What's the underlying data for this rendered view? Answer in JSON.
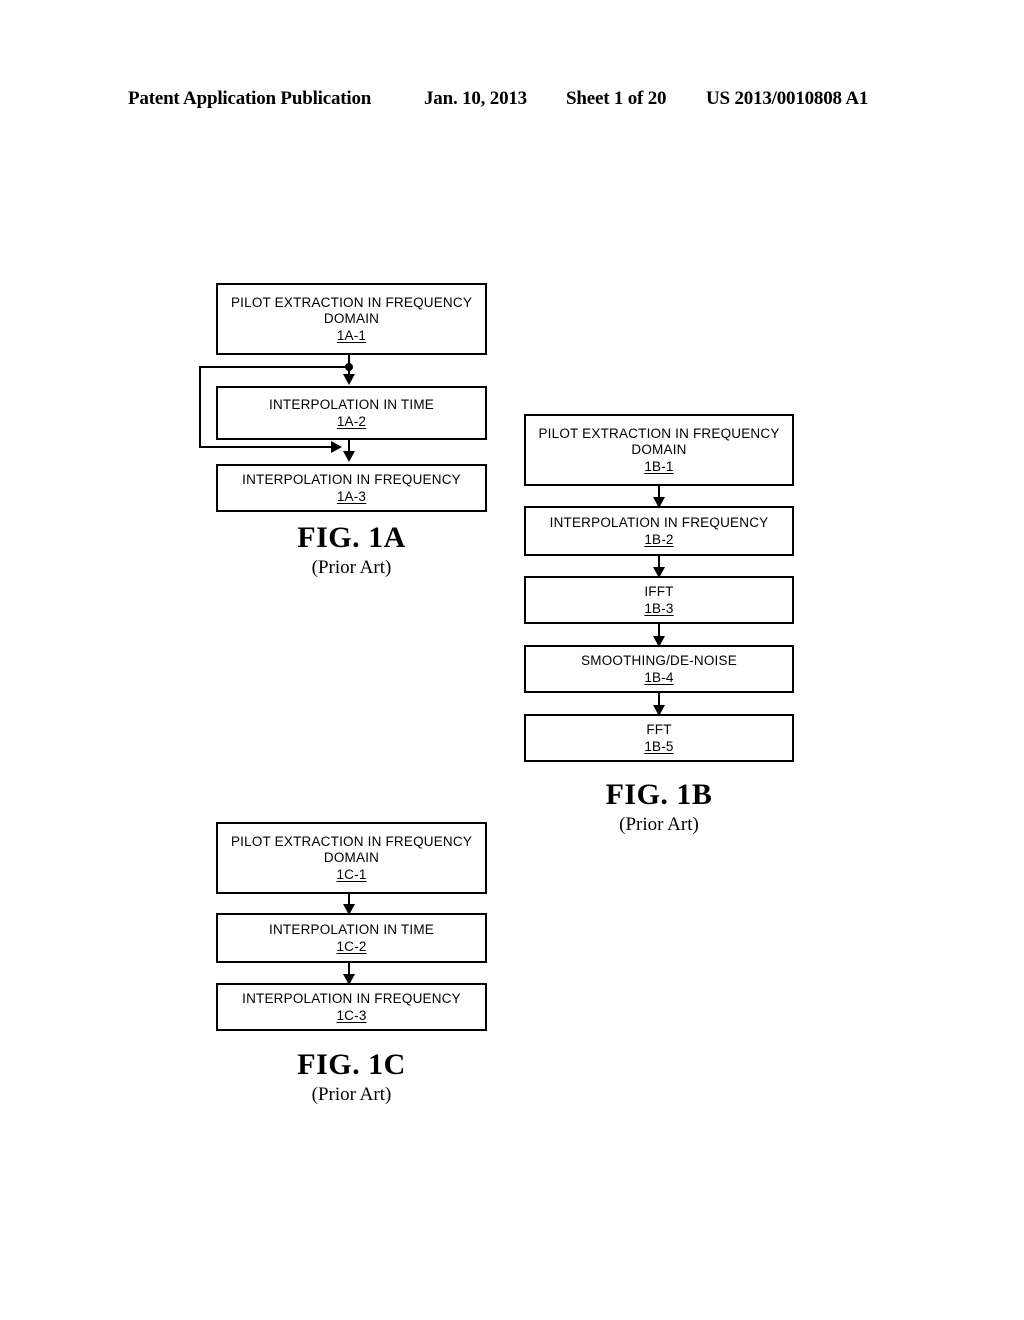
{
  "header": {
    "publication": "Patent Application Publication",
    "date": "Jan. 10, 2013",
    "sheet": "Sheet 1 of 20",
    "patent_number": "US 2013/0010808 A1"
  },
  "figures": [
    {
      "id": "fig-1a",
      "caption_main": "FIG. 1A",
      "caption_sub": "(Prior Art)",
      "boxes": [
        {
          "label": "PILOT EXTRACTION IN FREQUENCY\nDOMAIN",
          "ref": "1A-1"
        },
        {
          "label": "INTERPOLATION IN TIME",
          "ref": "1A-2"
        },
        {
          "label": "INTERPOLATION IN FREQUENCY",
          "ref": "1A-3"
        }
      ],
      "connectors": [
        {
          "type": "arrow-down",
          "from": "1A-1",
          "to": "1A-2"
        },
        {
          "type": "arrow-down",
          "from": "1A-2",
          "to": "1A-3"
        },
        {
          "type": "bypass",
          "from": "1A-1",
          "to": "1A-3",
          "note": "branch line bypassing INTERPOLATION IN TIME"
        }
      ]
    },
    {
      "id": "fig-1b",
      "caption_main": "FIG. 1B",
      "caption_sub": "(Prior Art)",
      "boxes": [
        {
          "label": "PILOT EXTRACTION IN FREQUENCY\nDOMAIN",
          "ref": "1B-1"
        },
        {
          "label": "INTERPOLATION IN FREQUENCY",
          "ref": "1B-2"
        },
        {
          "label": "IFFT",
          "ref": "1B-3"
        },
        {
          "label": "SMOOTHING/DE-NOISE",
          "ref": "1B-4"
        },
        {
          "label": "FFT",
          "ref": "1B-5"
        }
      ],
      "connectors": [
        {
          "type": "arrow-down",
          "from": "1B-1",
          "to": "1B-2"
        },
        {
          "type": "arrow-down",
          "from": "1B-2",
          "to": "1B-3"
        },
        {
          "type": "arrow-down",
          "from": "1B-3",
          "to": "1B-4"
        },
        {
          "type": "arrow-down",
          "from": "1B-4",
          "to": "1B-5"
        }
      ]
    },
    {
      "id": "fig-1c",
      "caption_main": "FIG. 1C",
      "caption_sub": "(Prior Art)",
      "boxes": [
        {
          "label": "PILOT EXTRACTION IN FREQUENCY\nDOMAIN",
          "ref": "1C-1"
        },
        {
          "label": "INTERPOLATION IN TIME",
          "ref": "1C-2"
        },
        {
          "label": "INTERPOLATION IN FREQUENCY",
          "ref": "1C-3"
        }
      ],
      "connectors": [
        {
          "type": "arrow-down",
          "from": "1C-1",
          "to": "1C-2"
        },
        {
          "type": "arrow-down",
          "from": "1C-2",
          "to": "1C-3"
        }
      ]
    }
  ],
  "colors": {
    "ink": "#000000",
    "paper": "#ffffff"
  }
}
